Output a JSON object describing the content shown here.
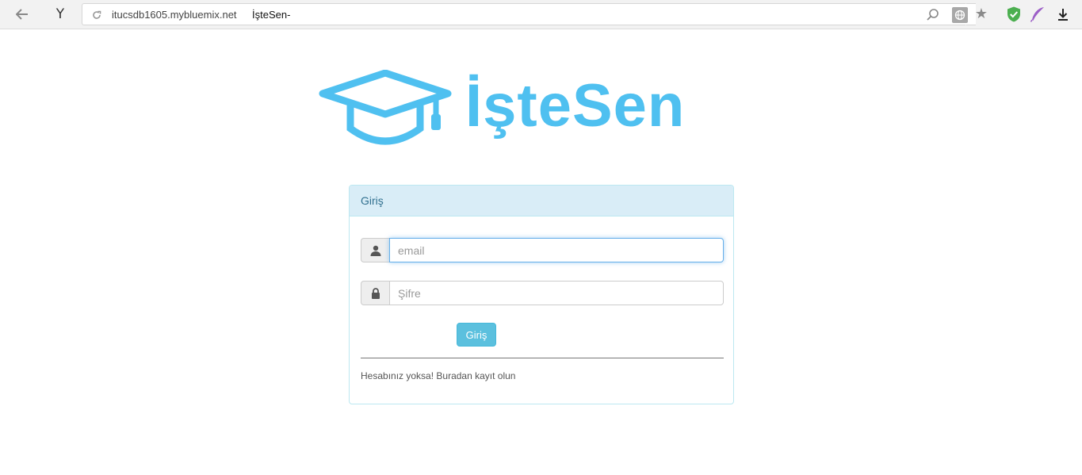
{
  "browser": {
    "url_domain": "itucsdb1605.mybluemix.net",
    "page_title": "İşteSen-",
    "yandex_glyph": "Y",
    "icons": [
      "back-arrow-icon",
      "yandex-icon",
      "reload-icon",
      "search-icon",
      "globe-icon",
      "star-icon",
      "shield-check-icon",
      "feather-icon",
      "download-icon"
    ]
  },
  "logo": {
    "text": "İşteSen",
    "icon": "graduation-cap-icon",
    "color": "#4fc0f0"
  },
  "login_panel": {
    "heading": "Giriş",
    "email_placeholder": "email",
    "password_placeholder": "Şifre",
    "submit_label": "Giriş",
    "register_prefix": "Hesabınız yoksa!",
    "register_link": "Buradan kayıt olun",
    "colors": {
      "heading_bg": "#d9edf7",
      "heading_text": "#31708f",
      "button_bg": "#5bc0de"
    }
  }
}
